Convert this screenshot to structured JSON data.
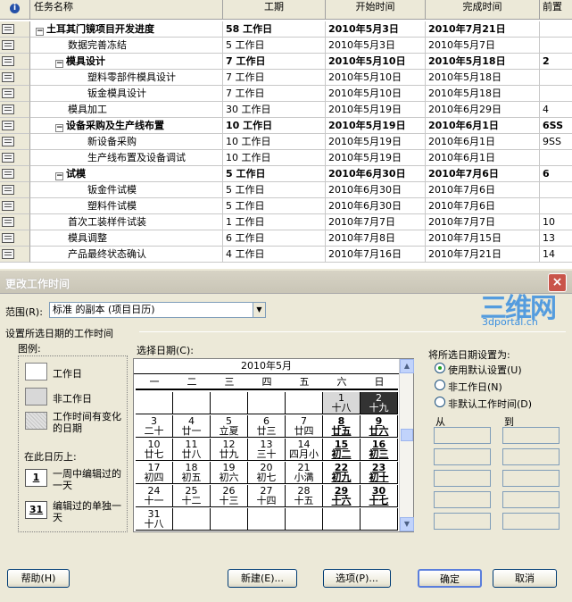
{
  "gantt": {
    "columns": {
      "info_icon": "i",
      "name": "任务名称",
      "duration": "工期",
      "start": "开始时间",
      "finish": "完成时间",
      "pred": "前置"
    },
    "rows": [
      {
        "name": "土耳其门镜项目开发进度",
        "duration": "58 工作日",
        "start": "2010年5月3日",
        "finish": "2010年7月21日",
        "pred": ""
      },
      {
        "name": "数据完善冻结",
        "duration": "5 工作日",
        "start": "2010年5月3日",
        "finish": "2010年5月7日",
        "pred": ""
      },
      {
        "name": "模具设计",
        "duration": "7 工作日",
        "start": "2010年5月10日",
        "finish": "2010年5月18日",
        "pred": "2"
      },
      {
        "name": "塑料零部件模具设计",
        "duration": "7 工作日",
        "start": "2010年5月10日",
        "finish": "2010年5月18日",
        "pred": ""
      },
      {
        "name": "钣金模具设计",
        "duration": "7 工作日",
        "start": "2010年5月10日",
        "finish": "2010年5月18日",
        "pred": ""
      },
      {
        "name": "模具加工",
        "duration": "30 工作日",
        "start": "2010年5月19日",
        "finish": "2010年6月29日",
        "pred": "4"
      },
      {
        "name": "设备采购及生产线布置",
        "duration": "10 工作日",
        "start": "2010年5月19日",
        "finish": "2010年6月1日",
        "pred": "6SS"
      },
      {
        "name": "新设备采购",
        "duration": "10 工作日",
        "start": "2010年5月19日",
        "finish": "2010年6月1日",
        "pred": "9SS"
      },
      {
        "name": "生产线布置及设备调试",
        "duration": "10 工作日",
        "start": "2010年5月19日",
        "finish": "2010年6月1日",
        "pred": ""
      },
      {
        "name": "试模",
        "duration": "5 工作日",
        "start": "2010年6月30日",
        "finish": "2010年7月6日",
        "pred": "6"
      },
      {
        "name": "钣金件试模",
        "duration": "5 工作日",
        "start": "2010年6月30日",
        "finish": "2010年7月6日",
        "pred": ""
      },
      {
        "name": "塑料件试模",
        "duration": "5 工作日",
        "start": "2010年6月30日",
        "finish": "2010年7月6日",
        "pred": ""
      },
      {
        "name": "首次工装样件试装",
        "duration": "1 工作日",
        "start": "2010年7月7日",
        "finish": "2010年7月7日",
        "pred": "10"
      },
      {
        "name": "模具调整",
        "duration": "6 工作日",
        "start": "2010年7月8日",
        "finish": "2010年7月15日",
        "pred": "13"
      },
      {
        "name": "产品最终状态确认",
        "duration": "4 工作日",
        "start": "2010年7月16日",
        "finish": "2010年7月21日",
        "pred": "14"
      }
    ]
  },
  "dialog": {
    "title": "更改工作时间",
    "close": "×",
    "range_label": "范围(R):",
    "range_value": "标准 的副本 (项目日历)",
    "section_label": "设置所选日期的工作时间",
    "legend_title": "图例:",
    "legend_work": "工作日",
    "legend_nonwork": "非工作日",
    "legend_changed": "工作时间有变化的日期",
    "legend_on_calendar": "在此日历上:",
    "legend_weekday_edited": "一周中编辑过的一天",
    "legend_day_edited": "编辑过的单独一天",
    "mini_weekday": "1",
    "mini_day": "31",
    "select_date_label": "选择日期(C):",
    "calendar": {
      "month": "2010年5月",
      "weekdays": [
        "一",
        "二",
        "三",
        "四",
        "五",
        "六",
        "日"
      ],
      "weeks": [
        [
          null,
          null,
          null,
          null,
          null,
          {
            "d": "1",
            "l": "十八",
            "t": "gray"
          },
          {
            "d": "2",
            "l": "十九",
            "t": "sel"
          }
        ],
        [
          {
            "d": "3",
            "l": "二十"
          },
          {
            "d": "4",
            "l": "廿一"
          },
          {
            "d": "5",
            "l": "立夏"
          },
          {
            "d": "6",
            "l": "廿三"
          },
          {
            "d": "7",
            "l": "廿四"
          },
          {
            "d": "8",
            "l": "廿五",
            "t": "bold"
          },
          {
            "d": "9",
            "l": "廿六",
            "t": "bold"
          }
        ],
        [
          {
            "d": "10",
            "l": "廿七"
          },
          {
            "d": "11",
            "l": "廿八"
          },
          {
            "d": "12",
            "l": "廿九"
          },
          {
            "d": "13",
            "l": "三十"
          },
          {
            "d": "14",
            "l": "四月小"
          },
          {
            "d": "15",
            "l": "初二",
            "t": "bold"
          },
          {
            "d": "16",
            "l": "初三",
            "t": "bold"
          }
        ],
        [
          {
            "d": "17",
            "l": "初四"
          },
          {
            "d": "18",
            "l": "初五"
          },
          {
            "d": "19",
            "l": "初六"
          },
          {
            "d": "20",
            "l": "初七"
          },
          {
            "d": "21",
            "l": "小满"
          },
          {
            "d": "22",
            "l": "初九",
            "t": "bold"
          },
          {
            "d": "23",
            "l": "初十",
            "t": "bold"
          }
        ],
        [
          {
            "d": "24",
            "l": "十一"
          },
          {
            "d": "25",
            "l": "十二"
          },
          {
            "d": "26",
            "l": "十三"
          },
          {
            "d": "27",
            "l": "十四"
          },
          {
            "d": "28",
            "l": "十五"
          },
          {
            "d": "29",
            "l": "十六",
            "t": "bold"
          },
          {
            "d": "30",
            "l": "十七",
            "t": "bold"
          }
        ],
        [
          {
            "d": "31",
            "l": "十八"
          },
          null,
          null,
          null,
          null,
          null,
          null
        ]
      ]
    },
    "set_as_label": "将所选日期设置为:",
    "opt_default": "使用默认设置(U)",
    "opt_nonwork": "非工作日(N)",
    "opt_nondefault": "非默认工作时间(D)",
    "from_label": "从",
    "to_label": "到",
    "buttons": {
      "help": "帮助(H)",
      "new": "新建(E)...",
      "options": "选项(P)...",
      "ok": "确定",
      "cancel": "取消"
    },
    "watermark": {
      "main": "三维网",
      "sub": "3dportal.cn"
    }
  }
}
